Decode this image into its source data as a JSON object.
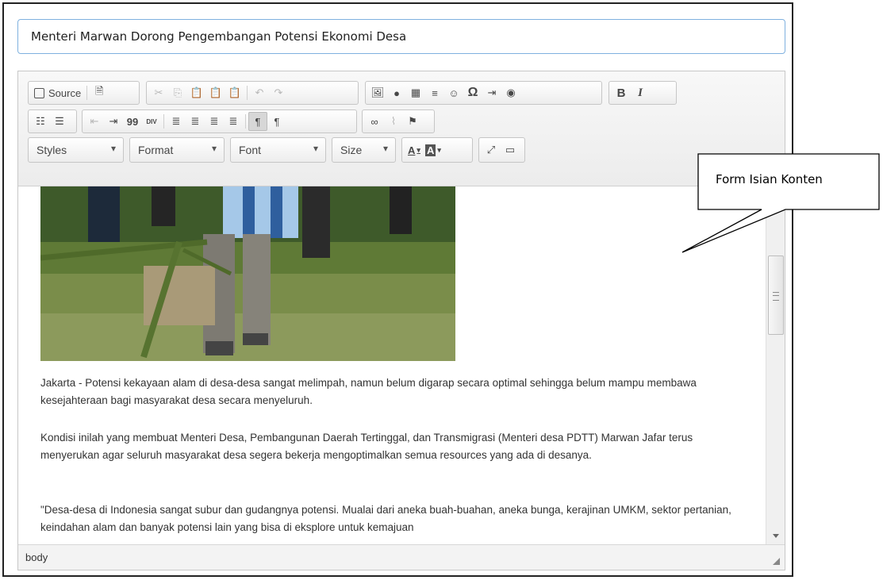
{
  "title_input": {
    "value": "Menteri Marwan Dorong Pengembangan Potensi Ekonomi Desa"
  },
  "toolbar": {
    "source_label": "Source",
    "styles_label": "Styles",
    "format_label": "Format",
    "font_label": "Font",
    "size_label": "Size",
    "bold_label": "B",
    "italic_label": "I",
    "omega_label": "Ω",
    "quote_label": "99",
    "div_label": "DIV",
    "text_color_label": "A",
    "bg_color_label": "A"
  },
  "content": {
    "paragraphs": [
      "Jakarta - Potensi kekayaan alam di desa-desa sangat melimpah, namun belum digarap secara optimal sehingga belum mampu membawa kesejahteraan bagi masyarakat desa secara menyeluruh.",
      "Kondisi inilah yang membuat Menteri Desa, Pembangunan Daerah Tertinggal, dan Transmigrasi (Menteri desa PDTT) Marwan Jafar terus menyerukan agar seluruh masyarakat desa segera bekerja mengoptimalkan semua resources yang ada di desanya.",
      "\"Desa-desa di Indonesia sangat subur dan gudangnya potensi. Mualai dari aneka buah-buahan, aneka bunga, kerajinan UMKM, sektor pertanian, keindahan alam dan banyak potensi lain yang bisa di eksplore untuk kemajuan"
    ]
  },
  "status_bar": {
    "path": "body"
  },
  "annotation": {
    "label": "Form Isian Konten"
  }
}
